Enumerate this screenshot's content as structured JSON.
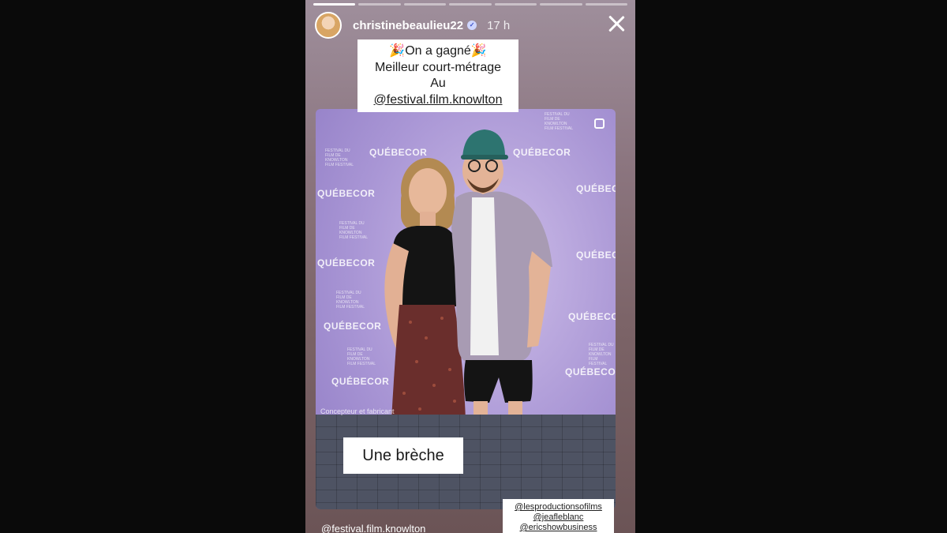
{
  "story": {
    "progress_total": 7,
    "progress_completed": 1,
    "username": "christinebeaulieu22",
    "verified_mark": "✓",
    "time_ago": "17 h",
    "caption": {
      "line1": "🎉On a gagné🎉",
      "line2": "Meilleur court-métrage",
      "line3": "Au",
      "line4": "@festival.film.knowlton"
    },
    "photo": {
      "backdrop_logo": "QUÉBECOR",
      "backdrop_small": "FESTIVAL DU FILM DE KNOWLTON FILM FESTIVAL",
      "bottom_text": "Concepteur et fabricant"
    },
    "title": "Une brèche",
    "tags": [
      "@lesproductionsofilms",
      "@jeafleblanc",
      "@ericshowbusiness"
    ],
    "mention": "@festival.film.knowlton"
  },
  "colors": {
    "letterbox": "#0a0a0a",
    "backdrop": "#a996d5",
    "floor": "#4e5363"
  },
  "icons": {
    "close": "close-icon",
    "verified": "verified-icon",
    "multi": "multi-post-icon"
  }
}
